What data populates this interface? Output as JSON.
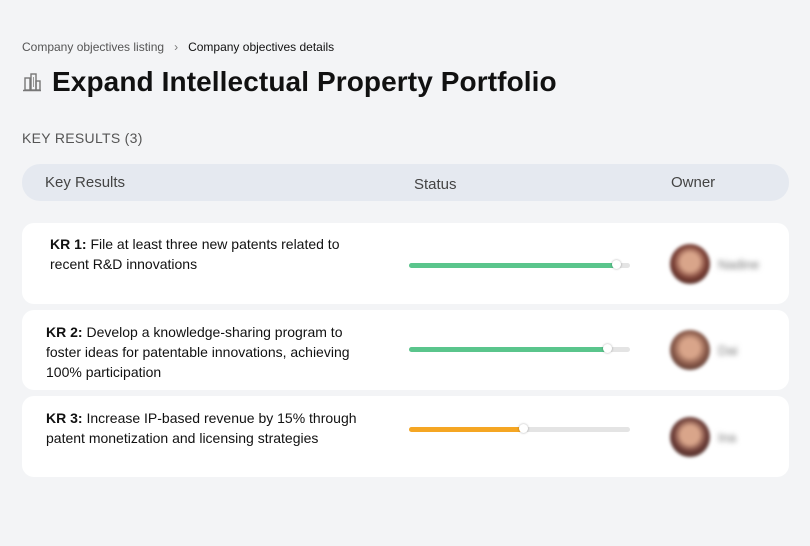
{
  "breadcrumb": {
    "parent": "Company objectives listing",
    "separator": "›",
    "current": "Company objectives details"
  },
  "objective": {
    "title": "Expand Intellectual Property Portfolio",
    "icon": "buildings-icon"
  },
  "key_results_section": {
    "label": "KEY RESULTS (3)"
  },
  "table": {
    "headers": {
      "key_results": "Key Results",
      "status": "Status",
      "owner": "Owner"
    },
    "rows": [
      {
        "prefix": "KR 1:",
        "text": "File at least three new patents related to recent R&D innovations",
        "progress": 0.94,
        "progress_color": "#5ac58c",
        "owner_name": "Nadine",
        "avatar_color": "#7a3f35"
      },
      {
        "prefix": "KR 2:",
        "text": "Develop a knowledge-sharing program to foster ideas for patentable innovations, achieving 100% participation",
        "progress": 0.9,
        "progress_color": "#5ac58c",
        "owner_name": "Dai",
        "avatar_color": "#8a5a4a"
      },
      {
        "prefix": "KR 3:",
        "text": "Increase IP-based revenue by 15% through patent monetization and licensing strategies",
        "progress": 0.52,
        "progress_color": "#f5a623",
        "owner_name": "Ina",
        "avatar_color": "#6e3e38"
      }
    ]
  },
  "colors": {
    "background": "#f3f4f6",
    "header_bg": "#e5e9f0",
    "track": "#e4e4e4"
  }
}
